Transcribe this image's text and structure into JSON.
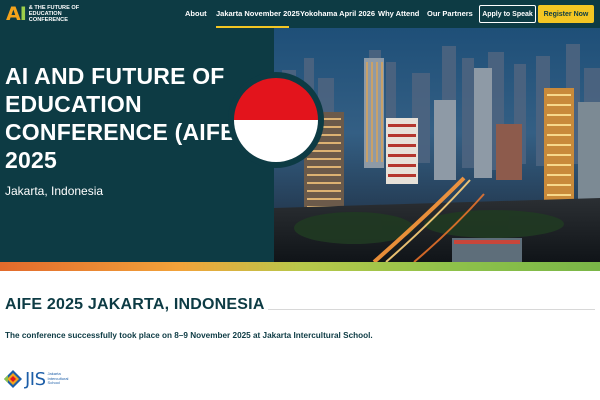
{
  "header": {
    "logo_mark_a": "A",
    "logo_mark_i": "I",
    "logo_text": "& THE FUTURE OF EDUCATION CONFERENCE",
    "nav": [
      {
        "label": "About"
      },
      {
        "label": "Jakarta November 2025",
        "active": true
      },
      {
        "label": "Yokohama April 2026"
      },
      {
        "label": "Why Attend"
      },
      {
        "label": "Our Partners"
      }
    ],
    "apply_label": "Apply to Speak",
    "register_label": "Register Now"
  },
  "hero": {
    "title": "AI AND FUTURE OF EDUCATION CONFERENCE (AIFE) 2025",
    "subtitle": "Jakarta, Indonesia",
    "flag": "indonesia-flag",
    "image": "jakarta-skyline-night"
  },
  "content": {
    "heading": "AIFE 2025 JAKARTA, INDONESIA",
    "body": "The conference successfully took place on 8–9 November 2025 at Jakarta Intercultural School."
  },
  "partner_logo": {
    "wordmark": "JIS",
    "caption": "Jakarta Intercultural School"
  },
  "colors": {
    "brand_teal": "#0d3b44",
    "accent_yellow": "#f3c623",
    "flag_red": "#e3141c",
    "jis_blue": "#1c5ea8"
  }
}
